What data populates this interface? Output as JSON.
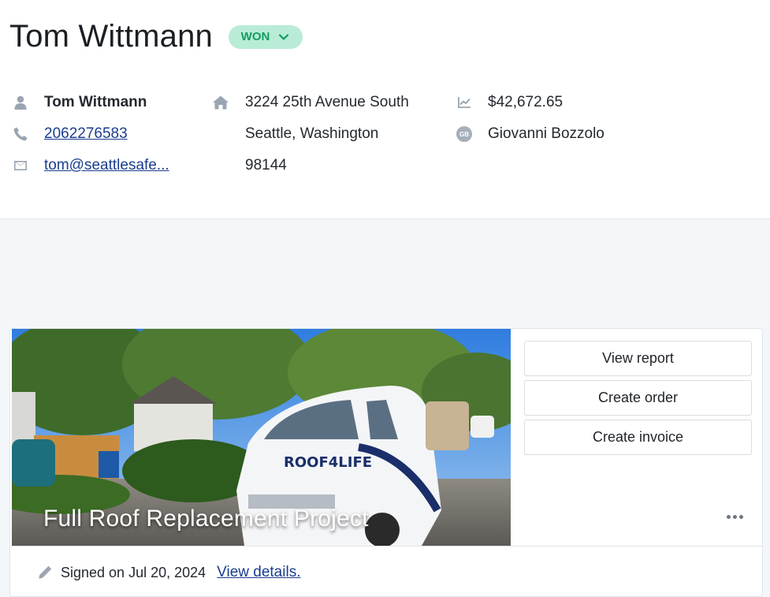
{
  "header": {
    "title": "Tom Wittmann",
    "status": "WON",
    "status_colors": {
      "bg": "#b9ecd6",
      "fg": "#139c63"
    }
  },
  "contact": {
    "name": "Tom Wittmann",
    "phone": "2062276583",
    "email": "tom@seattlesafe..."
  },
  "address": {
    "line1": "3224 25th Avenue South",
    "line2": "Seattle, Washington",
    "line3": "98144"
  },
  "deal": {
    "value": "$42,672.65",
    "owner_initials": "GB",
    "owner": "Giovanni Bozzolo"
  },
  "project": {
    "caption": "Full Roof Replacement Project",
    "actions": [
      "View report",
      "Create order",
      "Create invoice"
    ],
    "signed_text": "Signed on Jul 20, 2024",
    "details_link": "View details."
  },
  "icons": {
    "person": "user-icon",
    "phone": "phone-icon",
    "email": "envelope-icon",
    "home": "home-icon",
    "chart": "chart-icon",
    "edit": "pencil-icon",
    "more": "ellipsis-icon",
    "status": "chevron-down-icon"
  }
}
